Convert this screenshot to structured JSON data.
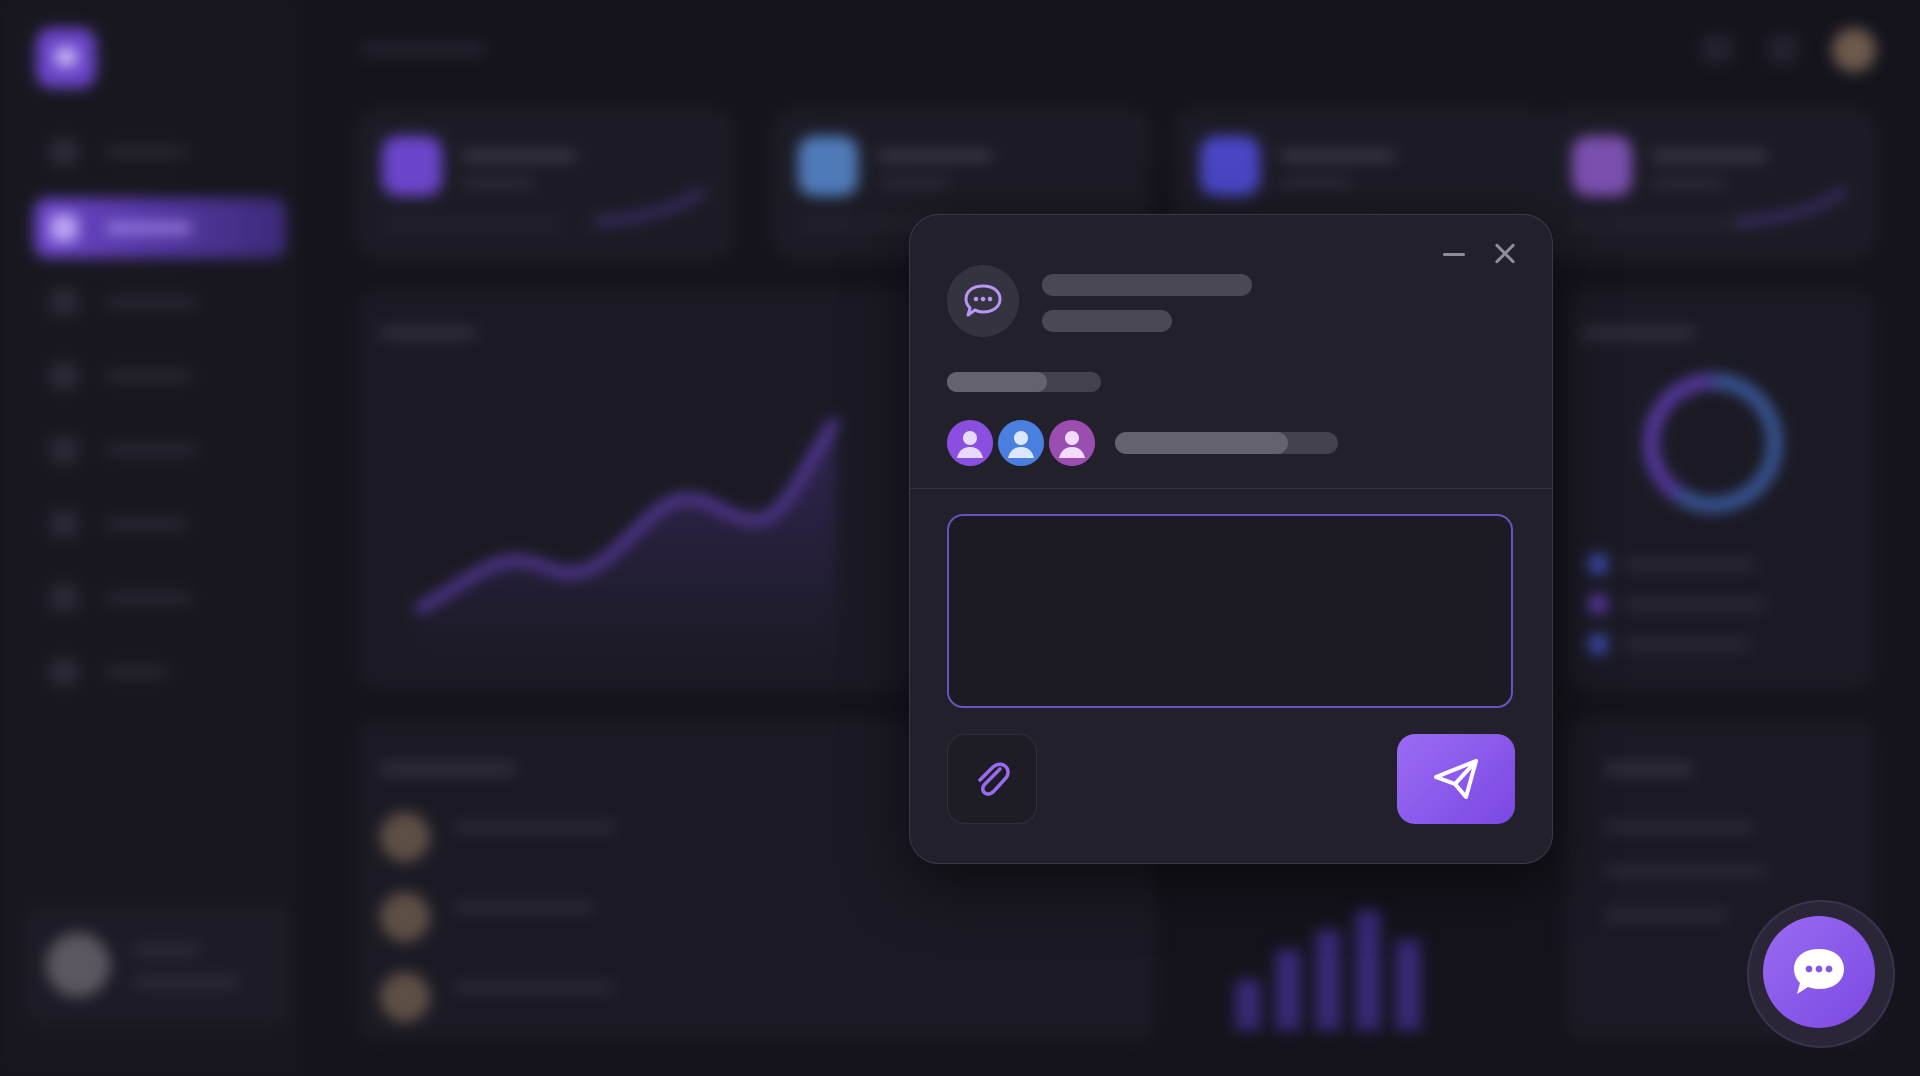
{
  "app": {
    "accent": "#8b5cf6",
    "background": "#15141d"
  },
  "sidebar": {
    "items": [
      {
        "icon": "home-icon",
        "active": false
      },
      {
        "icon": "dashboard-icon",
        "active": true
      },
      {
        "icon": "chart-icon",
        "active": false
      },
      {
        "icon": "users-icon",
        "active": false
      },
      {
        "icon": "calendar-icon",
        "active": false
      },
      {
        "icon": "folder-icon",
        "active": false
      },
      {
        "icon": "message-icon",
        "active": false
      },
      {
        "icon": "settings-icon",
        "active": false
      }
    ]
  },
  "stats": [
    {
      "icon": "stat-icon",
      "color": "#6a45c9"
    },
    {
      "icon": "stat-icon",
      "color": "#4f7ab8"
    },
    {
      "icon": "stat-icon",
      "color": "#4a46c4"
    },
    {
      "icon": "stat-icon",
      "color": "#7a4fae"
    }
  ],
  "modal": {
    "icon": "chat-bubble-icon",
    "message": {
      "value": "",
      "placeholder": ""
    },
    "participants": [
      {
        "icon": "person-icon",
        "color": "#8a4fe0"
      },
      {
        "icon": "person-icon",
        "color": "#4a7fe0"
      },
      {
        "icon": "person-icon",
        "color": "#9a4fb0"
      }
    ]
  },
  "floating_button": {
    "icon": "chat-bubble-icon"
  }
}
